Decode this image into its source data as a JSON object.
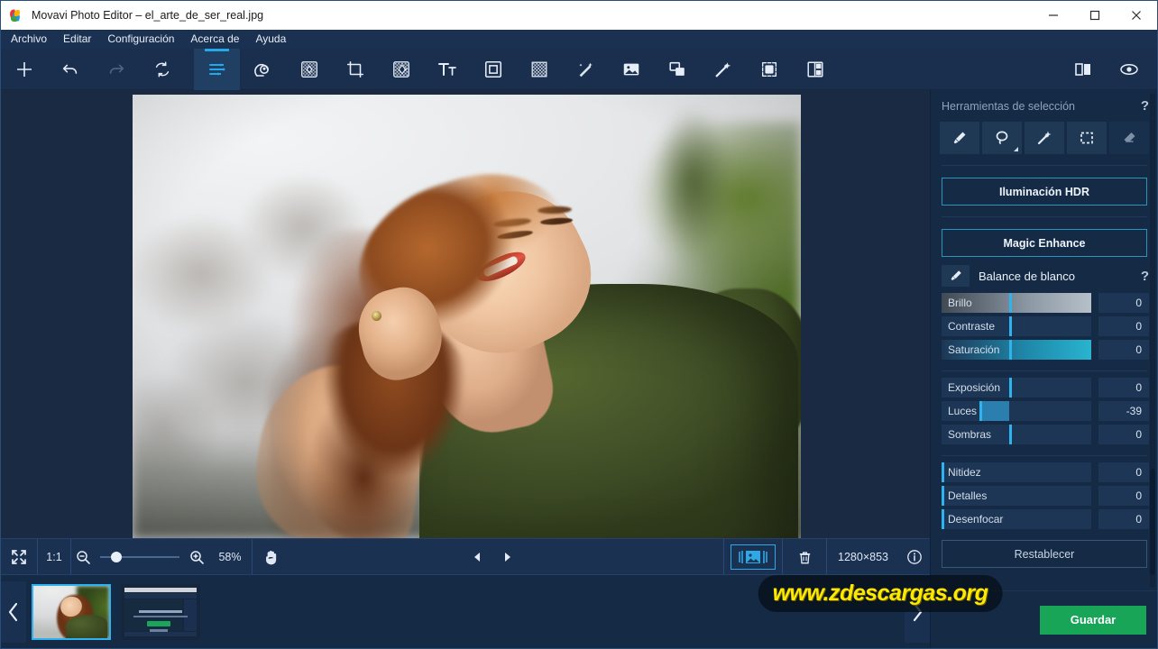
{
  "window": {
    "title": "Movavi Photo Editor – el_arte_de_ser_real.jpg",
    "app_icon": "movavi-logo-icon",
    "minimize_label": "—",
    "maximize_label": "□",
    "close_label": "✕"
  },
  "menu": {
    "items": [
      {
        "label": "Archivo"
      },
      {
        "label": "Editar"
      },
      {
        "label": "Configuración"
      },
      {
        "label": "Acerca de"
      },
      {
        "label": "Ayuda"
      }
    ]
  },
  "toolbar": {
    "left_tools": [
      {
        "name": "add-image-icon",
        "state": "enabled"
      },
      {
        "name": "undo-icon",
        "state": "enabled"
      },
      {
        "name": "redo-icon",
        "state": "disabled"
      },
      {
        "name": "reset-changes-icon",
        "state": "enabled"
      }
    ],
    "feature_tools": [
      {
        "name": "adjustments-icon",
        "state": "active"
      },
      {
        "name": "portrait-retouch-icon",
        "state": "enabled"
      },
      {
        "name": "object-removal-icon",
        "state": "enabled"
      },
      {
        "name": "crop-icon",
        "state": "enabled"
      },
      {
        "name": "background-removal-icon",
        "state": "enabled"
      },
      {
        "name": "text-icon",
        "state": "enabled"
      },
      {
        "name": "frame-icon",
        "state": "enabled"
      },
      {
        "name": "texture-icon",
        "state": "enabled"
      },
      {
        "name": "effects-icon",
        "state": "enabled"
      },
      {
        "name": "insert-picture-icon",
        "state": "enabled"
      },
      {
        "name": "overlay-shapes-icon",
        "state": "enabled"
      },
      {
        "name": "magic-wand-icon",
        "state": "enabled"
      },
      {
        "name": "change-background-icon",
        "state": "enabled"
      },
      {
        "name": "collage-icon",
        "state": "enabled"
      }
    ],
    "right_tools": [
      {
        "name": "before-after-split-icon",
        "state": "enabled"
      },
      {
        "name": "preview-eye-icon",
        "state": "enabled"
      }
    ]
  },
  "canvas": {
    "image_description": "Retrato de una mujer sonriendo con camiseta verde"
  },
  "bottombar": {
    "fit_screen_icon": "fit-to-screen-icon",
    "actual_size_label": "1:1",
    "zoom_out_icon": "zoom-out-icon",
    "zoom_in_icon": "zoom-in-icon",
    "zoom_level": "58%",
    "zoom_slider_position_pct": 18,
    "pan_tool_icon": "hand-pan-icon",
    "prev_icon": "previous-image-icon",
    "next_icon": "next-image-icon",
    "compare_icon": "compare-before-after-icon",
    "delete_icon": "trash-icon",
    "dimensions": "1280×853",
    "info_icon": "info-icon"
  },
  "right_panel": {
    "section_title": "Herramientas de selección",
    "help_label": "?",
    "selection_tools": [
      {
        "name": "selection-brush-icon",
        "state": "enabled"
      },
      {
        "name": "lasso-icon",
        "state": "enabled",
        "has_dropdown": true
      },
      {
        "name": "magic-wand-selection-icon",
        "state": "enabled"
      },
      {
        "name": "rectangular-marquee-icon",
        "state": "enabled"
      },
      {
        "name": "eraser-icon",
        "state": "disabled"
      }
    ],
    "hdr_button_label": "Iluminación HDR",
    "magic_enhance_button_label": "Magic Enhance",
    "white_balance": {
      "label": "Balance de blanco",
      "eyedropper_icon": "eyedropper-icon",
      "help_label": "?"
    },
    "sliders_group_1": [
      {
        "label": "Brillo",
        "value": "0",
        "handle_pct": 45,
        "style": "gray-gradient"
      },
      {
        "label": "Contraste",
        "value": "0",
        "handle_pct": 45,
        "style": "plain"
      },
      {
        "label": "Saturación",
        "value": "0",
        "handle_pct": 45,
        "style": "cyan-gradient"
      }
    ],
    "sliders_group_2": [
      {
        "label": "Exposición",
        "value": "0",
        "handle_pct": 45,
        "style": "plain"
      },
      {
        "label": "Luces",
        "value": "-39",
        "handle_pct": 25,
        "fill_from_pct": 25,
        "fill_to_pct": 45,
        "style": "plain"
      },
      {
        "label": "Sombras",
        "value": "0",
        "handle_pct": 45,
        "style": "plain"
      }
    ],
    "sliders_group_3": [
      {
        "label": "Nitidez",
        "value": "0",
        "handle_pct": 0,
        "style": "plain"
      },
      {
        "label": "Detalles",
        "value": "0",
        "handle_pct": 0,
        "style": "plain"
      },
      {
        "label": "Desenfocar",
        "value": "0",
        "handle_pct": 0,
        "style": "plain"
      }
    ],
    "reset_button_label": "Restablecer",
    "save_button_label": "Guardar"
  },
  "filmstrip": {
    "prev_icon": "filmstrip-previous-icon",
    "next_icon": "filmstrip-next-icon",
    "thumbnails": [
      {
        "name": "thumbnail-portrait",
        "selected": true
      },
      {
        "name": "thumbnail-screenshot",
        "selected": false
      }
    ]
  },
  "watermark": {
    "text": "www.zdescargas.org",
    "color": "#fde802"
  },
  "colors": {
    "accent_cyan": "#2fb3ef",
    "panel_bg": "#152a45",
    "toolbar_bg": "#1a2f4e",
    "save_green": "#18a558",
    "titlebar_bg": "#ffffff"
  }
}
